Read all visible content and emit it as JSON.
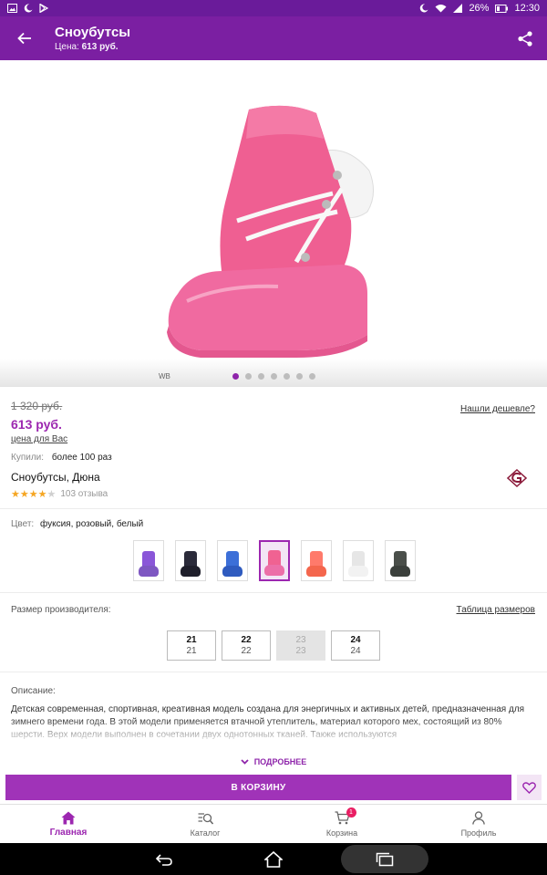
{
  "status_bar": {
    "battery": "26%",
    "time": "12:30"
  },
  "app_bar": {
    "title": "Сноубутсы",
    "subtitle_label": "Цена:",
    "subtitle_value": "613 руб."
  },
  "gallery": {
    "watermark": "WB",
    "slides_count": 7,
    "active_slide": 1
  },
  "price": {
    "old": "1 320 руб.",
    "current": "613 руб.",
    "for_you": "цена для Вас",
    "found_cheaper": "Нашли дешевле?"
  },
  "stats": {
    "bought_label": "Купили:",
    "bought_value": "более 100 раз"
  },
  "product": {
    "name": "Сноубутсы, Дюна",
    "rating": 4,
    "reviews": "103 отзыва"
  },
  "color": {
    "label": "Цвет:",
    "value": "фуксия, розовый, белый",
    "swatches": [
      {
        "top": "#8a56d8",
        "sole": "#7e57c2"
      },
      {
        "top": "#2b2b3a",
        "sole": "#1f1f2b"
      },
      {
        "top": "#3c6fd8",
        "sole": "#2f5bbf"
      },
      {
        "top": "#f06292",
        "sole": "#ec6fa8"
      },
      {
        "top": "#ff7a6b",
        "sole": "#f4664d"
      },
      {
        "top": "#e6e6e6",
        "sole": "#f2f2f2"
      },
      {
        "top": "#4a4f4a",
        "sole": "#3b403c"
      }
    ],
    "active_index": 3
  },
  "size": {
    "label": "Размер производителя:",
    "table_link": "Таблица размеров",
    "options": [
      {
        "size": "21",
        "sub": "21",
        "available": true
      },
      {
        "size": "22",
        "sub": "22",
        "available": true
      },
      {
        "size": "23",
        "sub": "23",
        "available": false
      },
      {
        "size": "24",
        "sub": "24",
        "available": true
      }
    ]
  },
  "description": {
    "label": "Описание:",
    "text": "Детская современная, спортивная, креативная модель создана для энергичных и активных детей, предназначенная для зимнего времени года. В этой модели применяется втачной утеплитель, материал которого мех, состоящий из 80% шерсти. Верх модели выполнен в сочетании двух однотонных тканей. Также используются",
    "more": "ПОДРОБНЕЕ"
  },
  "cart": {
    "button": "В КОРЗИНУ"
  },
  "bottom_nav": {
    "items": [
      {
        "label": "Главная",
        "icon": "home-icon"
      },
      {
        "label": "Каталог",
        "icon": "catalog-search-icon"
      },
      {
        "label": "Корзина",
        "icon": "cart-icon",
        "badge": "1"
      },
      {
        "label": "Профиль",
        "icon": "profile-icon"
      }
    ]
  },
  "colors": {
    "primary": "#7b1fa2",
    "accent": "#9c27b0",
    "button": "#a033b8"
  }
}
